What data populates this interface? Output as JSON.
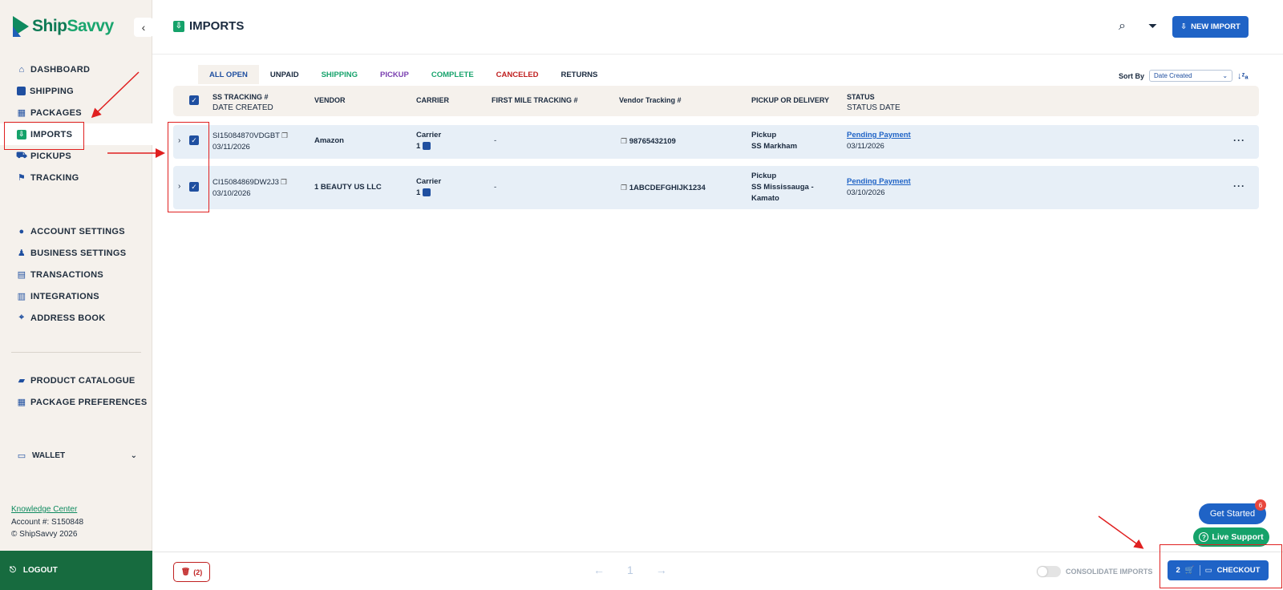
{
  "brand": {
    "name_part1": "Ship",
    "name_part2": "Savvy"
  },
  "sidebar": {
    "primary": [
      {
        "label": "DASHBOARD",
        "icon": "home-icon"
      },
      {
        "label": "SHIPPING",
        "icon": "shipping-icon"
      },
      {
        "label": "PACKAGES",
        "icon": "packages-icon"
      },
      {
        "label": "IMPORTS",
        "icon": "imports-icon",
        "active": true
      },
      {
        "label": "PICKUPS",
        "icon": "pickups-icon"
      },
      {
        "label": "TRACKING",
        "icon": "tracking-icon"
      }
    ],
    "secondary": [
      {
        "label": "ACCOUNT SETTINGS",
        "icon": "account-icon"
      },
      {
        "label": "BUSINESS SETTINGS",
        "icon": "business-icon"
      },
      {
        "label": "TRANSACTIONS",
        "icon": "transactions-icon"
      },
      {
        "label": "INTEGRATIONS",
        "icon": "integrations-icon"
      },
      {
        "label": "ADDRESS BOOK",
        "icon": "address-book-icon"
      }
    ],
    "tertiary": [
      {
        "label": "PRODUCT CATALOGUE",
        "icon": "catalogue-icon"
      },
      {
        "label": "PACKAGE PREFERENCES",
        "icon": "preferences-icon"
      }
    ],
    "wallet_label": "WALLET",
    "knowledge_center": "Knowledge Center",
    "account_number": "Account #: S150848",
    "copyright": "© ShipSavvy 2026",
    "logout_label": "LOGOUT"
  },
  "header": {
    "title": "IMPORTS",
    "new_import_label": "NEW IMPORT"
  },
  "tabs": [
    "ALL OPEN",
    "UNPAID",
    "SHIPPING",
    "PICKUP",
    "COMPLETE",
    "CANCELED",
    "RETURNS"
  ],
  "sort": {
    "label": "Sort By",
    "selected": "Date Created"
  },
  "table": {
    "headers": {
      "tracking": "SS TRACKING #",
      "date_created": "DATE CREATED",
      "vendor": "VENDOR",
      "carrier": "CARRIER",
      "first_mile": "FIRST MILE TRACKING #",
      "vendor_tracking": "Vendor Tracking #",
      "pickup_delivery": "PICKUP OR DELIVERY",
      "status": "STATUS",
      "status_date": "STATUS DATE"
    },
    "rows": [
      {
        "tracking": "SI15084870VDGBT",
        "date": "03/11/2026",
        "vendor": "Amazon",
        "carrier": "Carrier",
        "carrier_count": "1",
        "first_mile": "-",
        "vendor_tracking": "98765432109",
        "pickup": "Pickup",
        "location": "SS Markham",
        "location2": "",
        "status": "Pending Payment",
        "status_date": "03/11/2026"
      },
      {
        "tracking": "CI15084869DW2J3",
        "date": "03/10/2026",
        "vendor": "1 BEAUTY US LLC",
        "carrier": "Carrier",
        "carrier_count": "1",
        "first_mile": "-",
        "vendor_tracking": "1ABCDEFGHIJK1234",
        "pickup": "Pickup",
        "location": "SS Mississauga -",
        "location2": "Kamato",
        "status": "Pending Payment",
        "status_date": "03/10/2026"
      }
    ]
  },
  "bottom": {
    "delete_count": "(2)",
    "page": "1",
    "consolidate_label": "CONSOLIDATE IMPORTS",
    "cart_count": "2",
    "checkout_label": "CHECKOUT"
  },
  "widgets": {
    "get_started": "Get Started",
    "badge": "6",
    "live_support": "Live Support"
  },
  "colors": {
    "primary_blue": "#1f63c6",
    "brand_green": "#15a26a",
    "logout_green": "#176b3f",
    "sidebar_bg": "#f5f1ec",
    "row_bg": "#e7eff7",
    "annotation_red": "#e02020"
  }
}
